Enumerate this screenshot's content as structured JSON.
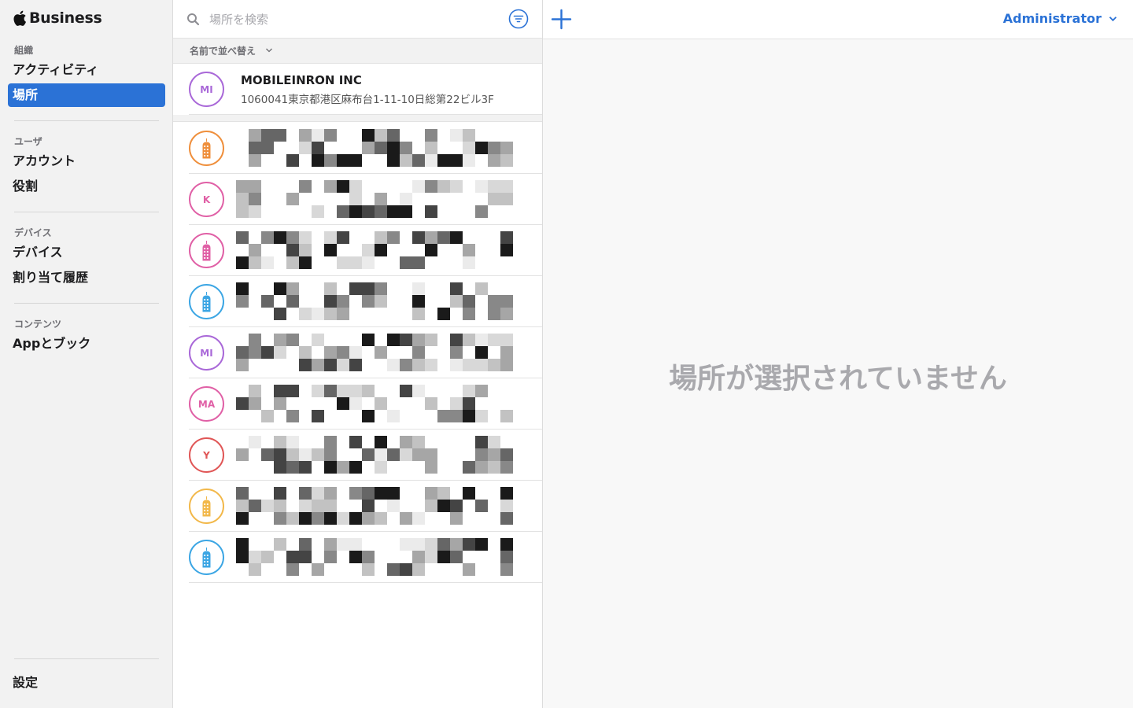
{
  "brand": {
    "logo": "apple-logo",
    "name": "Business"
  },
  "sidebar": {
    "sections": [
      {
        "label": "組織",
        "items": [
          {
            "label": "アクティビティ",
            "active": false
          },
          {
            "label": "場所",
            "active": true
          }
        ]
      },
      {
        "label": "ユーザ",
        "items": [
          {
            "label": "アカウント",
            "active": false
          },
          {
            "label": "役割",
            "active": false
          }
        ]
      },
      {
        "label": "デバイス",
        "items": [
          {
            "label": "デバイス",
            "active": false
          },
          {
            "label": "割り当て履歴",
            "active": false
          }
        ]
      },
      {
        "label": "コンテンツ",
        "items": [
          {
            "label": "Appとブック",
            "active": false
          }
        ]
      }
    ],
    "settings_label": "設定"
  },
  "search": {
    "placeholder": "場所を検索",
    "value": ""
  },
  "sort": {
    "label": "名前で並べ替え"
  },
  "locations": [
    {
      "avatar_text": "MI",
      "icon": "initials",
      "color": "#a968d8",
      "title": "MOBILEINRON INC",
      "address": "1060041東京都港区麻布台1-11-10日総第22ビル3F"
    },
    {
      "avatar_text": "",
      "icon": "building-icon",
      "color": "#ef8f3c",
      "redacted": true
    },
    {
      "avatar_text": "K",
      "icon": "initials",
      "color": "#e060a6",
      "redacted": true
    },
    {
      "avatar_text": "",
      "icon": "building-icon",
      "color": "#e060a6",
      "redacted": true
    },
    {
      "avatar_text": "",
      "icon": "building-icon",
      "color": "#3ca6e4",
      "redacted": true
    },
    {
      "avatar_text": "MI",
      "icon": "initials",
      "color": "#a968d8",
      "redacted": true
    },
    {
      "avatar_text": "MA",
      "icon": "initials",
      "color": "#e060a6",
      "redacted": true
    },
    {
      "avatar_text": "Y",
      "icon": "initials",
      "color": "#e05656",
      "redacted": true
    },
    {
      "avatar_text": "",
      "icon": "building-icon",
      "color": "#f2b84a",
      "redacted": true
    },
    {
      "avatar_text": "",
      "icon": "building-icon",
      "color": "#3ca6e4",
      "redacted": true
    }
  ],
  "header": {
    "add_icon": "plus-icon",
    "user_label": "Administrator"
  },
  "detail": {
    "empty_message": "場所が選択されていません"
  },
  "colors": {
    "accent": "#2b72d6",
    "sidebar_bg": "#f2f2f2",
    "empty_text": "#a9a9ad"
  }
}
